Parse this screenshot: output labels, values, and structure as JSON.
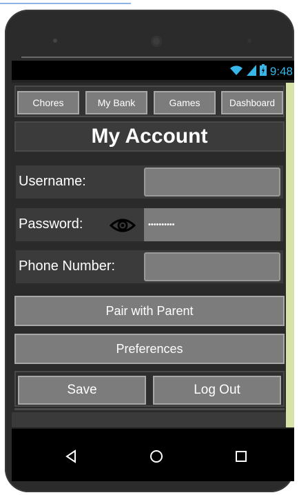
{
  "status_bar": {
    "time": "9:48",
    "icons": [
      "wifi-icon",
      "signal-icon",
      "battery-icon"
    ],
    "accent_color": "#38b6e8"
  },
  "tabs": [
    {
      "label": "Chores"
    },
    {
      "label": "My Bank"
    },
    {
      "label": "Games"
    },
    {
      "label": "Dashboard"
    }
  ],
  "title": "My Account",
  "form": {
    "username_label": "Username:",
    "username_value": "",
    "password_label": "Password:",
    "password_value": "••••••••••",
    "phone_label": "Phone Number:",
    "phone_value": ""
  },
  "buttons": {
    "pair": "Pair with Parent",
    "preferences": "Preferences",
    "save": "Save",
    "logout": "Log Out"
  },
  "nav": [
    "back-icon",
    "home-icon",
    "recents-icon"
  ]
}
